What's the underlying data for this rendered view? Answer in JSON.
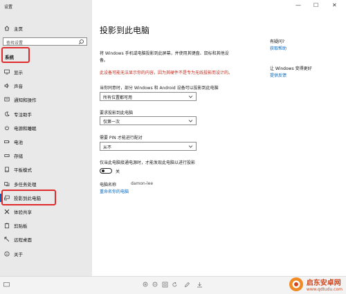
{
  "window": {
    "title": "设置"
  },
  "sidebar": {
    "home": "主页",
    "search_placeholder": "查找设置",
    "section": "系统",
    "items": [
      {
        "label": "显示",
        "icon": "monitor-icon"
      },
      {
        "label": "声音",
        "icon": "speaker-icon"
      },
      {
        "label": "通知和操作",
        "icon": "notification-icon"
      },
      {
        "label": "专注助手",
        "icon": "moon-icon"
      },
      {
        "label": "电源和睡眠",
        "icon": "power-icon"
      },
      {
        "label": "电池",
        "icon": "battery-icon"
      },
      {
        "label": "存储",
        "icon": "storage-icon"
      },
      {
        "label": "平板模式",
        "icon": "tablet-icon"
      },
      {
        "label": "多任务处理",
        "icon": "multitask-icon"
      },
      {
        "label": "投影到此电脑",
        "icon": "project-icon",
        "active": true
      },
      {
        "label": "体验共享",
        "icon": "share-icon"
      },
      {
        "label": "剪贴板",
        "icon": "clipboard-icon"
      },
      {
        "label": "远程桌面",
        "icon": "remote-icon"
      },
      {
        "label": "关于",
        "icon": "info-icon"
      }
    ]
  },
  "main": {
    "title": "投影到此电脑",
    "description": "将 Windows 手机或电脑投影到此屏幕，并使用其键盘、鼠标和其他设备。",
    "warning": "此设备可能无法显示你的内容，因为其硬件不是专为无线投影而设计的。",
    "q1": {
      "label": "当你同意时，部分 Windows 和 Android 设备可以投影到此电脑",
      "value": "所有位置都可用"
    },
    "q2": {
      "label": "要求投影到此电脑",
      "value": "仅第一次"
    },
    "q3": {
      "label": "需要 PIN 才能进行配对",
      "value": "从不"
    },
    "power_option": {
      "label": "仅当此电脑接通电源时，才能发现此电脑以进行投影",
      "state": "关",
      "on": false
    },
    "pc_name": {
      "label": "电脑名称",
      "value": "damon-lee"
    },
    "rename_link": "重命名你的电脑"
  },
  "aside": {
    "q_heading": "有疑问?",
    "help_link": "获取帮助",
    "improve_heading": "让 Windows 变得更好",
    "feedback_link": "提供反馈"
  },
  "watermark": {
    "brand": "启东安卓网",
    "url": "www.qdtudu.com"
  },
  "colors": {
    "accent": "#0067c0",
    "warning": "#c42b1c",
    "highlight": "#e02a2a"
  }
}
